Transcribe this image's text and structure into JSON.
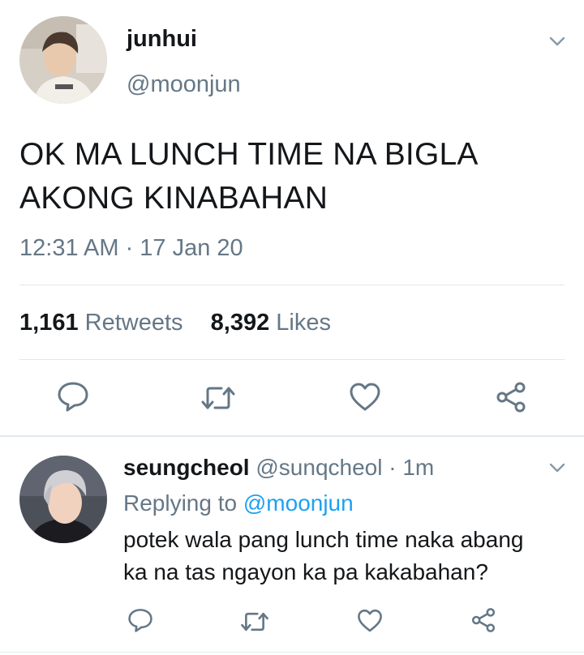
{
  "tweet": {
    "display_name": "junhui",
    "handle": "@moonjun",
    "text_lines": [
      "OK MA LUNCH TIME NA BIGLA",
      "AKONG KINABAHAN"
    ],
    "timestamp": "12:31 AM · 17 Jan 20",
    "retweets_count": "1,161",
    "retweets_label": "Retweets",
    "likes_count": "8,392",
    "likes_label": "Likes",
    "actions": [
      "reply-icon",
      "retweet-icon",
      "like-icon",
      "share-icon"
    ]
  },
  "reply": {
    "display_name": "seungcheol",
    "handle": "@sunqcheol",
    "separator": "·",
    "time_ago": "1m",
    "replying_prefix": "Replying to",
    "replying_to": "@moonjun",
    "text_lines": [
      "potek wala pang lunch time naka abang",
      "ka na tas ngayon ka pa kakabahan?"
    ],
    "actions": [
      "reply-icon",
      "retweet-icon",
      "like-icon",
      "share-icon"
    ]
  },
  "colors": {
    "text_primary": "#14171a",
    "text_secondary": "#657786",
    "link": "#1da1f2",
    "divider": "#e1e8ed"
  }
}
